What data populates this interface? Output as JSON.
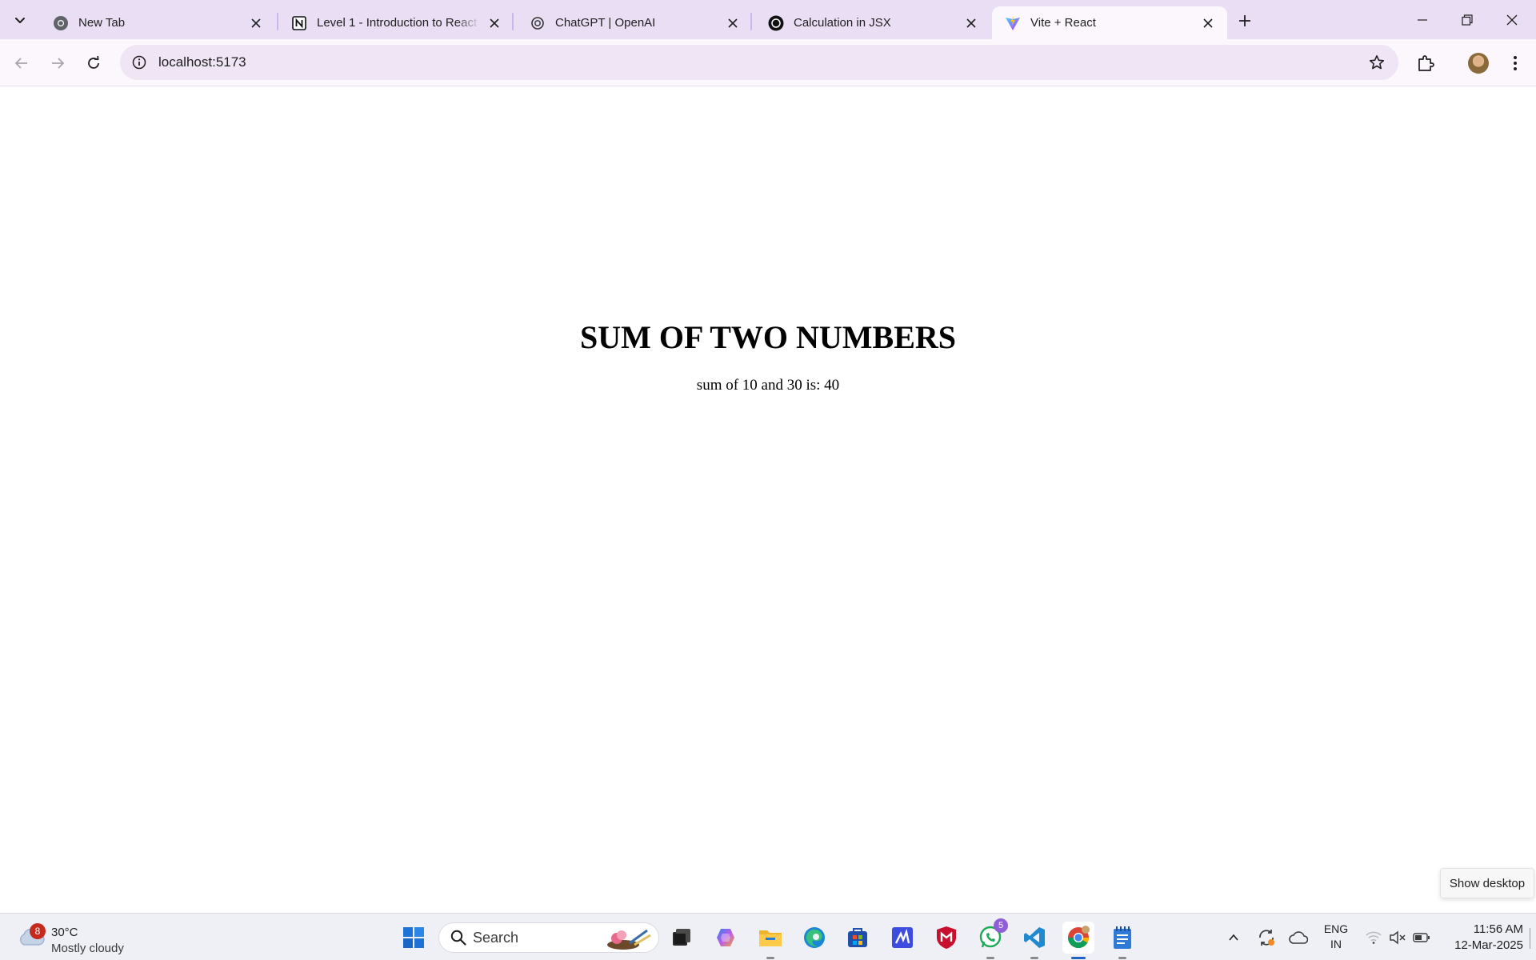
{
  "browser": {
    "tabs": [
      {
        "title": "New Tab",
        "icon": "chrome-icon"
      },
      {
        "title": "Level 1 - Introduction to React",
        "icon": "notion-icon"
      },
      {
        "title": "ChatGPT | OpenAI",
        "icon": "openai-icon"
      },
      {
        "title": "Calculation in JSX",
        "icon": "openai-icon"
      },
      {
        "title": "Vite + React",
        "icon": "vite-icon",
        "active": true
      }
    ],
    "address": "localhost:5173"
  },
  "page": {
    "heading": "SUM OF TWO NUMBERS",
    "text": "sum of 10 and 30 is: 40"
  },
  "tooltip": {
    "show_desktop": "Show desktop"
  },
  "taskbar": {
    "weather": {
      "badge": "8",
      "temp": "30°C",
      "condition": "Mostly cloudy"
    },
    "search_label": "Search",
    "whatsapp_badge": "5",
    "lang_line1": "ENG",
    "lang_line2": "IN",
    "time": "11:56 AM",
    "date": "12-Mar-2025"
  },
  "colors": {
    "tabstrip": "#e9def3",
    "toolbar": "#fbf7fd",
    "omnibox": "#efe5f4",
    "taskbar": "#eef0f6"
  }
}
